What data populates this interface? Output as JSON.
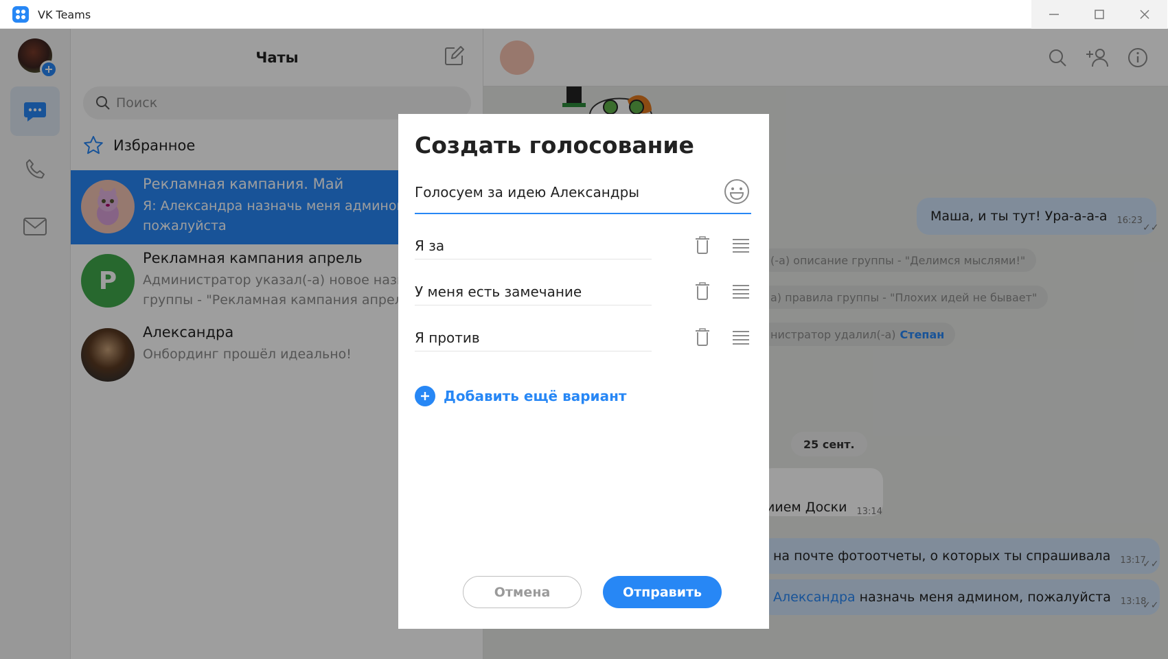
{
  "app": {
    "title": "VK Teams"
  },
  "icons": {
    "app_logo": "vk-teams-logo",
    "minimize": "minimize-icon",
    "maximize": "maximize-icon",
    "close": "close-icon",
    "chats": "chat-bubble-icon",
    "calls": "phone-icon",
    "mail": "mail-icon",
    "compose": "compose-icon",
    "search": "search-icon",
    "favorites": "star-icon",
    "header_search": "search-icon",
    "add_member": "add-user-icon",
    "info": "info-icon",
    "emoji": "emoji-icon",
    "delete": "trash-icon",
    "drag": "drag-handle-icon",
    "add": "plus-icon"
  },
  "colors": {
    "accent": "#2787f5",
    "outgoing_bubble": "#cfe3f8",
    "overlay": "rgba(0,0,0,0.38)"
  },
  "chatlist": {
    "title": "Чаты",
    "search_placeholder": "Поиск",
    "favorites_label": "Избранное",
    "chats": [
      {
        "name": "Рекламная кампания. Май",
        "preview": "Я: Александра назначь меня админом,\nпожалуйста",
        "active": true,
        "avatar_letter": ""
      },
      {
        "name": "Рекламная кампания апрель",
        "preview": "Администратор указал(-а) новое назва\nгруппы - \"Рекламная кампания апрель\"",
        "active": false,
        "avatar_letter": "Р"
      },
      {
        "name": "Александра",
        "preview": "Онбординг прошёл идеально!",
        "active": false,
        "avatar_letter": ""
      }
    ]
  },
  "conversation": {
    "messages": [
      {
        "text": "Маша, и ты тут! Ура-а-а-а",
        "time": "16:23"
      },
      {
        "text": "иием Доски",
        "time": "13:14"
      },
      {
        "text": "на почте фотоотчеты, о которых ты спрашивала",
        "time": "13:17"
      },
      {
        "mention": "Александра",
        "text": "назначь меня админом, пожалуйста",
        "time": "13:18"
      }
    ],
    "system": [
      {
        "text": "(-а) описание группы - \"Делимся мыслями!\""
      },
      {
        "text": "а) правила группы - \"Плохих идей не бывает\""
      },
      {
        "text": "нистратор удалил(-а)",
        "highlight": "Степан"
      }
    ],
    "date_separator": "25 сент."
  },
  "poll_dialog": {
    "title": "Создать голосование",
    "question": "Голосуем за идею Александры",
    "options": [
      "Я за",
      "У меня есть замечание",
      "Я против"
    ],
    "add_option_label": "Добавить ещё вариант",
    "cancel_label": "Отмена",
    "send_label": "Отправить"
  }
}
